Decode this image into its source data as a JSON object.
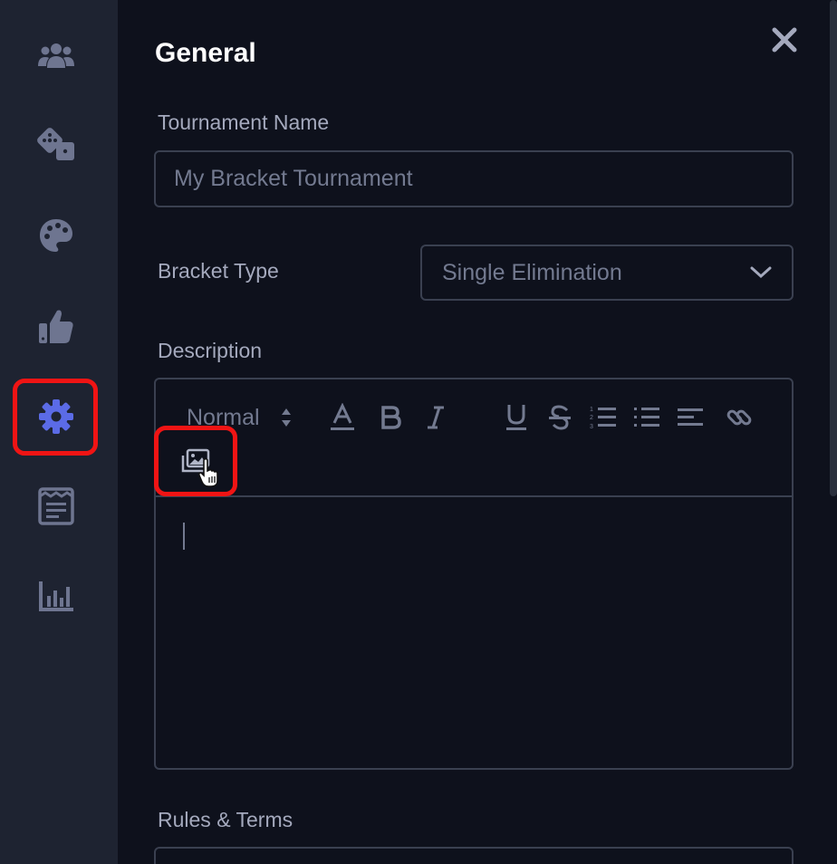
{
  "sidebar": {
    "items": [
      {
        "name": "users-icon"
      },
      {
        "name": "dice-icon"
      },
      {
        "name": "palette-icon"
      },
      {
        "name": "thumbs-up-icon"
      },
      {
        "name": "gear-icon",
        "selected": true
      },
      {
        "name": "newspaper-icon"
      },
      {
        "name": "bar-chart-icon"
      }
    ],
    "accent_color": "#5b6be6",
    "icon_color": "#6e7590"
  },
  "panel": {
    "title": "General",
    "close_icon": "close-icon",
    "tournament_name": {
      "label": "Tournament Name",
      "placeholder": "My Bracket Tournament",
      "value": ""
    },
    "bracket_type": {
      "label": "Bracket Type",
      "value": "Single Elimination"
    },
    "description": {
      "label": "Description",
      "toolbar": {
        "format_value": "Normal",
        "buttons": [
          "text-color-icon",
          "bold-icon",
          "italic-icon",
          "underline-icon",
          "strikethrough-icon",
          "ordered-list-icon",
          "bullet-list-icon",
          "align-left-icon",
          "link-icon",
          "image-icon"
        ]
      },
      "value": ""
    },
    "rules": {
      "label": "Rules & Terms"
    }
  },
  "highlight_color": "#f01414"
}
